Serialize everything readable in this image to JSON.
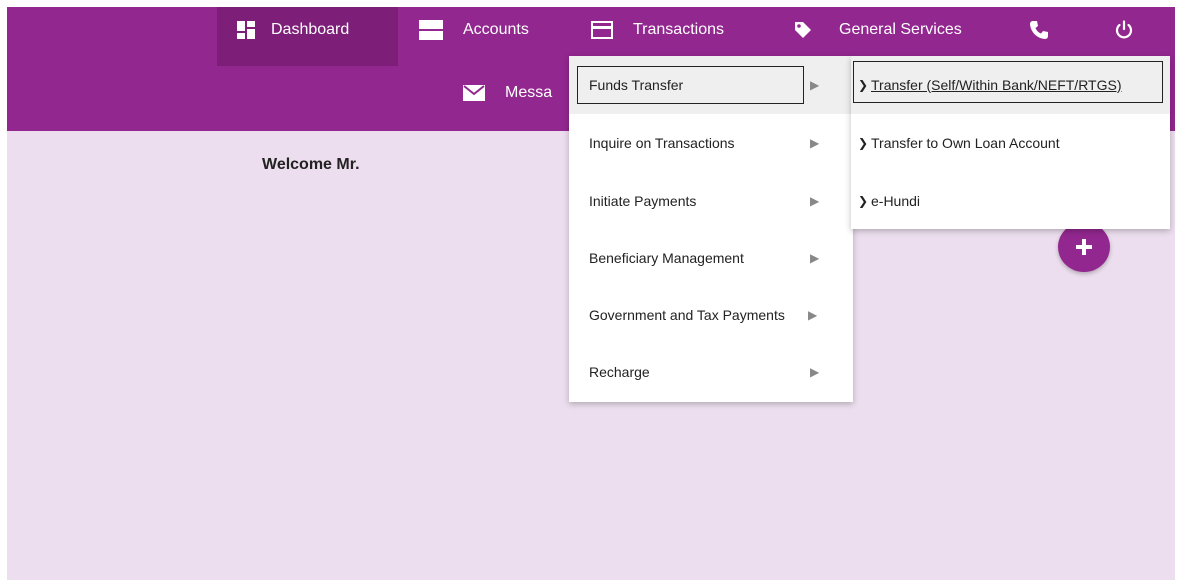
{
  "nav": {
    "items": [
      {
        "label": "Dashboard",
        "icon": "dashboard-icon"
      },
      {
        "label": "Accounts",
        "icon": "accounts-icon"
      },
      {
        "label": "Transactions",
        "icon": "transactions-icon"
      },
      {
        "label": "General Services",
        "icon": "tag-icon"
      }
    ],
    "messages_label": "Messa",
    "phone_icon": "phone-icon",
    "power_icon": "power-icon"
  },
  "welcome": {
    "text": "Welcome Mr."
  },
  "plus_button": {
    "icon": "plus-icon"
  },
  "transactions_menu": {
    "items": [
      {
        "label": "Funds Transfer",
        "arrow": "▶"
      },
      {
        "label": "Inquire on Transactions",
        "arrow": "▶"
      },
      {
        "label": "Initiate Payments",
        "arrow": "▶"
      },
      {
        "label": "Beneficiary Management",
        "arrow": "▶"
      },
      {
        "label": "Government and Tax Payments",
        "arrow": "▶"
      },
      {
        "label": "Recharge",
        "arrow": "▶"
      }
    ]
  },
  "funds_transfer_submenu": {
    "items": [
      {
        "label": "Transfer (Self/Within Bank/NEFT/RTGS)"
      },
      {
        "label": "Transfer to Own Loan Account"
      },
      {
        "label": "e-Hundi"
      }
    ]
  },
  "colors": {
    "brand_purple": "#92278f",
    "nav_active": "#7d1f79",
    "background_lavender": "#ecdeee"
  }
}
